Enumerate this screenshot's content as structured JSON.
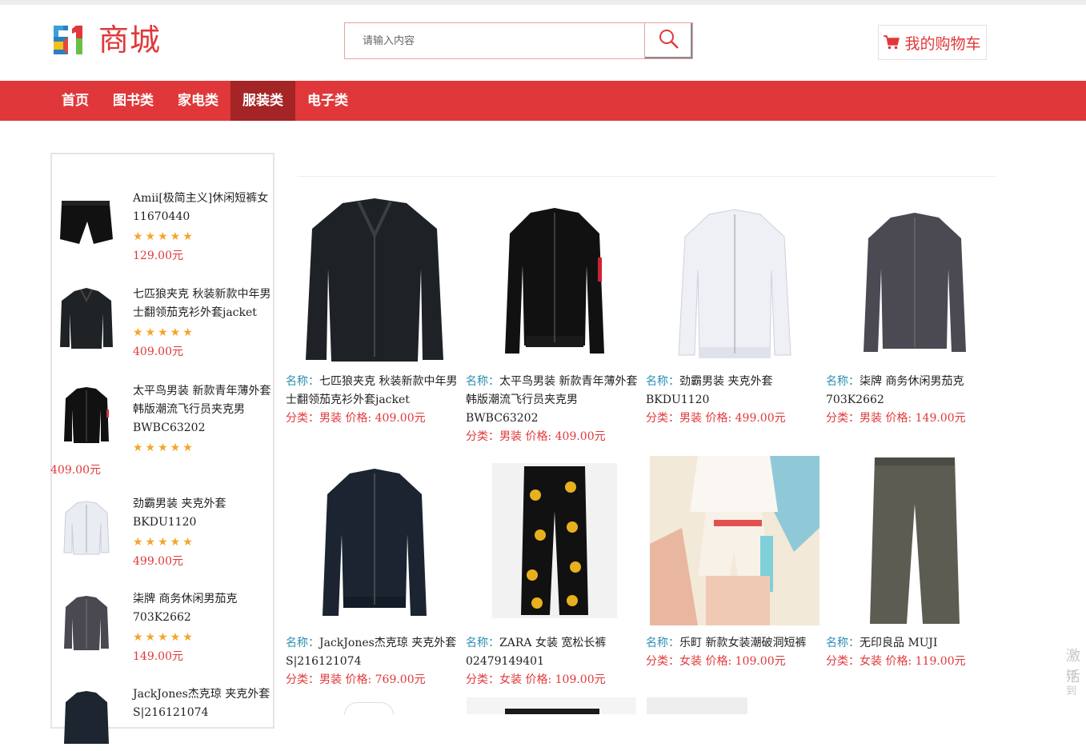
{
  "header": {
    "logo_text": "商城",
    "logo_number": "51",
    "search_placeholder": "请输入内容",
    "cart_label": "我的购物车"
  },
  "nav": {
    "items": [
      "首页",
      "图书类",
      "家电类",
      "服装类",
      "电子类"
    ],
    "active": "服装类"
  },
  "sidebar": {
    "items": [
      {
        "title": "Amii[极简主义]休闲短裤女11670440",
        "price": "129.00元",
        "stars": "★★★★★"
      },
      {
        "title": "七匹狼夹克 秋装新款中年男士翻领茄克衫外套jacket",
        "price": "409.00元",
        "stars": "★★★★★"
      },
      {
        "title": "太平鸟男装 新款青年薄外套韩版潮流飞行员夹克男BWBC63202",
        "price": "409.00元",
        "stars": "★★★★★"
      },
      {
        "title": "劲霸男装 夹克外套BKDU1120",
        "price": "499.00元",
        "stars": "★★★★★"
      },
      {
        "title": "柒牌 商务休闲男茄克703K2662",
        "price": "149.00元",
        "stars": "★★★★★"
      },
      {
        "title": "JackJones杰克琼 夹克外套S|216121074",
        "price": "",
        "stars": ""
      }
    ]
  },
  "labels": {
    "name": "名称：",
    "category": "分类：",
    "price": "价格:"
  },
  "products": [
    {
      "name": "七匹狼夹克 秋装新款中年男士翻领茄克衫外套jacket",
      "category": "男装",
      "price": "409.00元"
    },
    {
      "name": "太平鸟男装 新款青年薄外套韩版潮流飞行员夹克男BWBC63202",
      "category": "男装",
      "price": "409.00元"
    },
    {
      "name": "劲霸男装 夹克外套BKDU1120",
      "category": "男装",
      "price": "499.00元"
    },
    {
      "name": "柒牌 商务休闲男茄克703K2662",
      "category": "男装",
      "price": "149.00元"
    },
    {
      "name": "JackJones杰克琼 夹克外套S|216121074",
      "category": "男装",
      "price": "769.00元"
    },
    {
      "name": "ZARA 女装 宽松长裤02479149401",
      "category": "女装",
      "price": "109.00元"
    },
    {
      "name": "乐町 新款女装潮破洞短裤",
      "category": "女装",
      "price": "109.00元"
    },
    {
      "name": "无印良品 MUJI",
      "category": "女装",
      "price": "119.00元"
    }
  ],
  "watermark": {
    "line1": "激活",
    "line2": "转到"
  },
  "colors": {
    "brand_red": "#e0383a",
    "nav_active": "#a52426",
    "label_blue": "#2b8fb5",
    "star": "#f3a52b"
  }
}
